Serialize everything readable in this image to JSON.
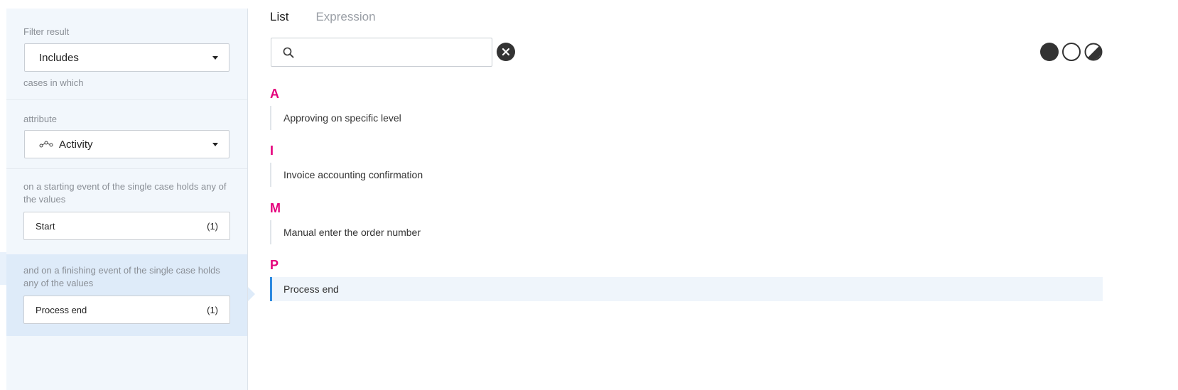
{
  "filter_panel": {
    "filter_result_label": "Filter result",
    "filter_result_value": "Includes",
    "cases_label": "cases in which",
    "attribute_label": "attribute",
    "attribute_value": "Activity",
    "start_condition_label": "on a starting event of the single case holds any of the values",
    "start_value": "Start",
    "start_count": "(1)",
    "end_condition_label": "and on a finishing event of the single case holds any of the values",
    "end_value": "Process end",
    "end_count": "(1)"
  },
  "tabs": [
    {
      "label": "List",
      "active": true
    },
    {
      "label": "Expression",
      "active": false
    }
  ],
  "search": {
    "value": "",
    "placeholder": ""
  },
  "mode_icons": [
    "filled-circle-icon",
    "empty-circle-icon",
    "half-circle-icon"
  ],
  "groups": [
    {
      "letter": "A",
      "items": [
        "Approving on specific level"
      ]
    },
    {
      "letter": "I",
      "items": [
        "Invoice accounting confirmation"
      ]
    },
    {
      "letter": "M",
      "items": [
        "Manual enter the order number"
      ]
    },
    {
      "letter": "P",
      "items": [
        "Process end"
      ]
    }
  ],
  "selected_item": "Process end",
  "colors": {
    "accent_letter": "#e4007c",
    "selection_bar": "#2d8ae0",
    "panel_bg": "#f2f7fc",
    "panel_selected_bg": "#deebf9"
  }
}
